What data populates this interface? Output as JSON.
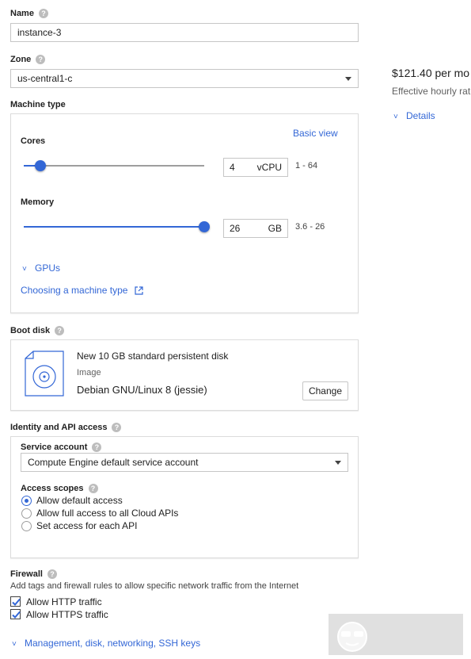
{
  "name": {
    "label": "Name",
    "value": "instance-3"
  },
  "zone": {
    "label": "Zone",
    "value": "us-central1-c"
  },
  "pricing": {
    "monthly": "$121.40 per mo",
    "hourly": "Effective hourly rat",
    "details": "Details"
  },
  "machine_type": {
    "label": "Machine type",
    "basic_view": "Basic view",
    "cores": {
      "label": "Cores",
      "value": "4",
      "unit": "vCPU",
      "range": "1 - 64",
      "slider_fraction": 0.0
    },
    "memory": {
      "label": "Memory",
      "value": "26",
      "unit": "GB",
      "range": "3.6 - 26",
      "slider_fraction": 1.0
    },
    "gpus": "GPUs",
    "choosing_link": "Choosing a machine type"
  },
  "boot_disk": {
    "label": "Boot disk",
    "title": "New 10 GB standard persistent disk",
    "image_label": "Image",
    "image": "Debian GNU/Linux 8 (jessie)",
    "change": "Change"
  },
  "identity": {
    "label": "Identity and API access",
    "service_account_label": "Service account",
    "service_account": "Compute Engine default service account",
    "scopes_label": "Access scopes",
    "scopes": [
      {
        "label": "Allow default access",
        "selected": true
      },
      {
        "label": "Allow full access to all Cloud APIs",
        "selected": false
      },
      {
        "label": "Set access for each API",
        "selected": false
      }
    ]
  },
  "firewall": {
    "label": "Firewall",
    "description": "Add tags and firewall rules to allow specific network traffic from the Internet",
    "options": [
      {
        "label": "Allow HTTP traffic",
        "checked": true
      },
      {
        "label": "Allow HTTPS traffic",
        "checked": true
      }
    ]
  },
  "management_link": "Management, disk, networking, SSH keys",
  "colors": {
    "accent": "#3367d6",
    "border": "#c6c6c6"
  }
}
